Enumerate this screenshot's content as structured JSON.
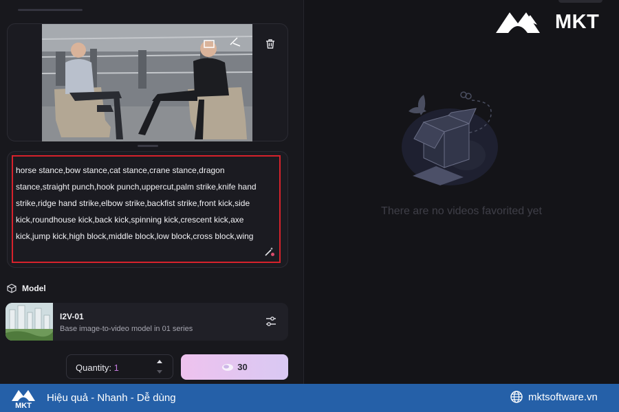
{
  "prompt": {
    "text": "horse stance,bow stance,cat stance,crane stance,dragon stance,straight punch,hook punch,uppercut,palm strike,knife hand strike,ridge hand strike,elbow strike,backfist strike,front kick,side kick,roundhouse kick,back kick,spinning kick,crescent kick,axe kick,jump kick,high block,middle block,low block,cross block,wing"
  },
  "model": {
    "section_label": "Model",
    "name": "I2V-01",
    "description": "Base image-to-video model in 01 series"
  },
  "quantity": {
    "label": "Quantity: ",
    "value": "1"
  },
  "generate": {
    "credits": "30"
  },
  "favorites": {
    "empty_text": "There are no videos favorited yet"
  },
  "brand": {
    "logo_text": "MKT",
    "footer_logo_text": "MKT",
    "slogan": "Hiệu quả - Nhanh - Dễ dùng",
    "website": "mktsoftware.vn"
  },
  "colors": {
    "highlight_border": "#d8222c",
    "footer_bg": "#2560a8",
    "generate_gradient_start": "#eec2ee",
    "generate_gradient_end": "#d9c9f3",
    "quantity_value": "#c77de0"
  },
  "icons": {
    "delete": "trash-icon",
    "prompt_magic": "magic-wand-icon",
    "model_section": "cube-icon",
    "model_settings": "sliders-icon",
    "quantity_up": "chevron-up-icon",
    "quantity_down": "chevron-down-icon",
    "credit": "gem-icon",
    "website": "globe-icon"
  }
}
